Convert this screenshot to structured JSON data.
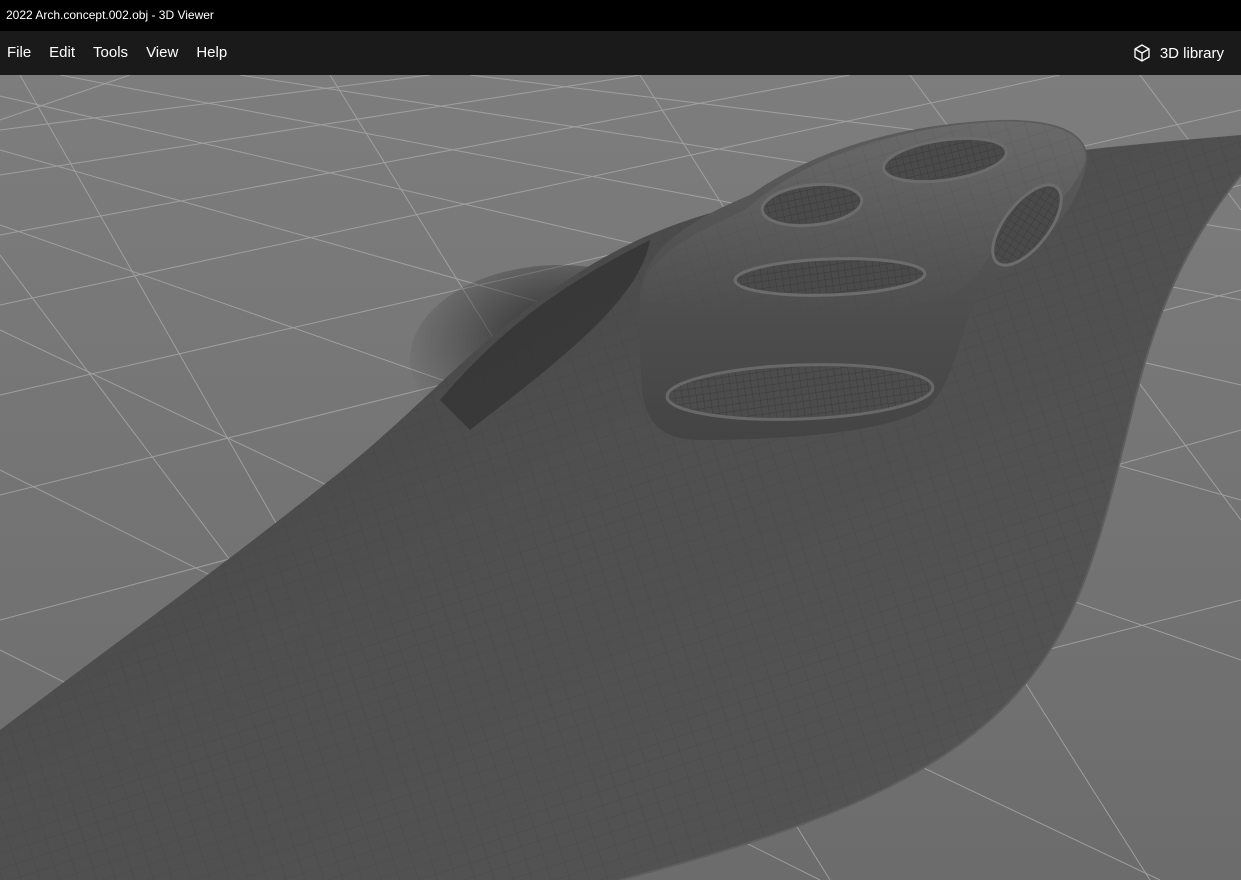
{
  "window": {
    "title": "2022 Arch.concept.002.obj - 3D Viewer"
  },
  "menu": {
    "items": [
      {
        "label": "File"
      },
      {
        "label": "Edit"
      },
      {
        "label": "Tools"
      },
      {
        "label": "View"
      },
      {
        "label": "Help"
      }
    ],
    "library_label": "3D library",
    "library_icon": "cube-icon"
  },
  "viewport": {
    "content": "3D model of an organic architectural concept on a curved terrain surface",
    "grid_visible": true,
    "colors": {
      "background": "#747474",
      "grid_line": "#a6a6a6",
      "surface": "#4c4c4c",
      "model": "#595959"
    }
  }
}
